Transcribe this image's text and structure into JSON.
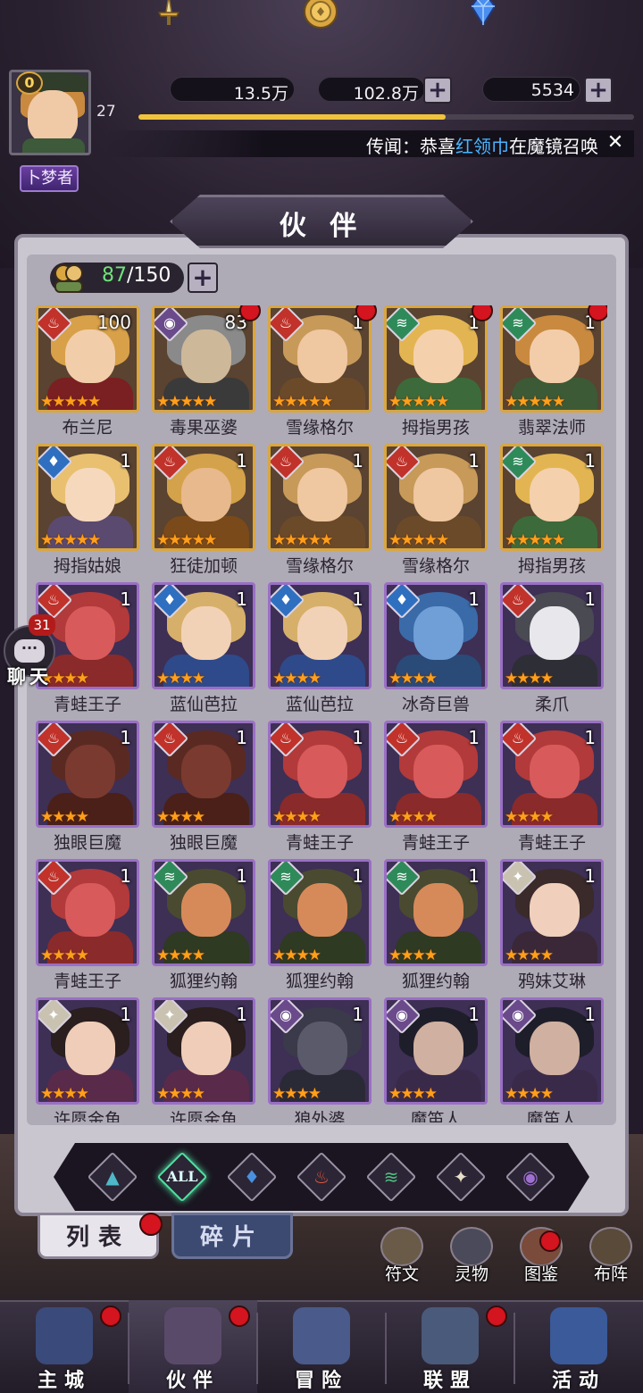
{
  "player": {
    "vip": "0",
    "level": "27",
    "exp_fraction": 0.62,
    "title": "卜梦者"
  },
  "resources": {
    "power": "13.5万",
    "gold": "102.8万",
    "diamond": "5534"
  },
  "rumor": {
    "prefix": "传闻：恭喜",
    "highlight": "红领巾",
    "suffix": "在魔镜召唤"
  },
  "panel": {
    "title": "伙 伴",
    "count_current": "87",
    "count_total": "/150"
  },
  "heroes": [
    {
      "name": "布兰尼",
      "level": "100",
      "stars": 5,
      "element": "fire",
      "frame": "gold",
      "dot": false,
      "hair": "#d8a048",
      "face": "#f2cda9",
      "body": "#7a1f22"
    },
    {
      "name": "毒果巫婆",
      "level": "83",
      "stars": 5,
      "element": "shadow",
      "frame": "gold",
      "dot": true,
      "hair": "#8a8a8a",
      "face": "#cdb89a",
      "body": "#3a3a3a"
    },
    {
      "name": "雪缘格尔",
      "level": "1",
      "stars": 5,
      "element": "fire",
      "frame": "gold",
      "dot": true,
      "hair": "#c79a5a",
      "face": "#efc7a0",
      "body": "#6b4a2a"
    },
    {
      "name": "拇指男孩",
      "level": "1",
      "stars": 5,
      "element": "wind",
      "frame": "gold",
      "dot": true,
      "hair": "#e3b552",
      "face": "#f4d0ac",
      "body": "#3d6a3a"
    },
    {
      "name": "翡翠法师",
      "level": "1",
      "stars": 5,
      "element": "wind",
      "frame": "gold",
      "dot": true,
      "hair": "#c98a3f",
      "face": "#f3cdaa",
      "body": "#3c5a36"
    },
    {
      "name": "拇指姑娘",
      "level": "1",
      "stars": 5,
      "element": "water",
      "frame": "gold",
      "dot": false,
      "hair": "#e8c070",
      "face": "#f6d8bd",
      "body": "#5a4a70"
    },
    {
      "name": "狂徒加顿",
      "level": "1",
      "stars": 5,
      "element": "fire",
      "frame": "gold",
      "dot": false,
      "hair": "#d4a24a",
      "face": "#e8b98c",
      "body": "#7a4a1a"
    },
    {
      "name": "雪缘格尔",
      "level": "1",
      "stars": 5,
      "element": "fire",
      "frame": "gold",
      "dot": false,
      "hair": "#c79a5a",
      "face": "#efc7a0",
      "body": "#6b4a2a"
    },
    {
      "name": "雪缘格尔",
      "level": "1",
      "stars": 5,
      "element": "fire",
      "frame": "gold",
      "dot": false,
      "hair": "#c79a5a",
      "face": "#efc7a0",
      "body": "#6b4a2a"
    },
    {
      "name": "拇指男孩",
      "level": "1",
      "stars": 5,
      "element": "wind",
      "frame": "gold",
      "dot": false,
      "hair": "#e3b552",
      "face": "#f4d0ac",
      "body": "#3d6a3a"
    },
    {
      "name": "青蛙王子",
      "level": "1",
      "stars": 4,
      "element": "fire",
      "frame": "purple",
      "dot": false,
      "hair": "#b23a3a",
      "face": "#d85a5a",
      "body": "#8a2a2a"
    },
    {
      "name": "蓝仙芭拉",
      "level": "1",
      "stars": 4,
      "element": "water",
      "frame": "purple",
      "dot": false,
      "hair": "#d6b06a",
      "face": "#f2d2b6",
      "body": "#2e4a8a"
    },
    {
      "name": "蓝仙芭拉",
      "level": "1",
      "stars": 4,
      "element": "water",
      "frame": "purple",
      "dot": false,
      "hair": "#d6b06a",
      "face": "#f2d2b6",
      "body": "#2e4a8a"
    },
    {
      "name": "冰奇巨兽",
      "level": "1",
      "stars": 4,
      "element": "water",
      "frame": "purple",
      "dot": false,
      "hair": "#3a6aa8",
      "face": "#6f9fd6",
      "body": "#2a4a78"
    },
    {
      "name": "柔爪",
      "level": "1",
      "stars": 4,
      "element": "fire",
      "frame": "purple",
      "dot": false,
      "hair": "#4a4a52",
      "face": "#e8e8ec",
      "body": "#2e2e36"
    },
    {
      "name": "独眼巨魔",
      "level": "1",
      "stars": 4,
      "element": "fire",
      "frame": "purple",
      "dot": false,
      "hair": "#5a2a22",
      "face": "#7a3a30",
      "body": "#4a2018"
    },
    {
      "name": "独眼巨魔",
      "level": "1",
      "stars": 4,
      "element": "fire",
      "frame": "purple",
      "dot": false,
      "hair": "#5a2a22",
      "face": "#7a3a30",
      "body": "#4a2018"
    },
    {
      "name": "青蛙王子",
      "level": "1",
      "stars": 4,
      "element": "fire",
      "frame": "purple",
      "dot": false,
      "hair": "#b23a3a",
      "face": "#d85a5a",
      "body": "#8a2a2a"
    },
    {
      "name": "青蛙王子",
      "level": "1",
      "stars": 4,
      "element": "fire",
      "frame": "purple",
      "dot": false,
      "hair": "#b23a3a",
      "face": "#d85a5a",
      "body": "#8a2a2a"
    },
    {
      "name": "青蛙王子",
      "level": "1",
      "stars": 4,
      "element": "fire",
      "frame": "purple",
      "dot": false,
      "hair": "#b23a3a",
      "face": "#d85a5a",
      "body": "#8a2a2a"
    },
    {
      "name": "青蛙王子",
      "level": "1",
      "stars": 4,
      "element": "fire",
      "frame": "purple",
      "dot": false,
      "hair": "#b23a3a",
      "face": "#d85a5a",
      "body": "#8a2a2a"
    },
    {
      "name": "狐狸约翰",
      "level": "1",
      "stars": 4,
      "element": "wind",
      "frame": "purple",
      "dot": false,
      "hair": "#4a4a30",
      "face": "#d68a5a",
      "body": "#2e3a22"
    },
    {
      "name": "狐狸约翰",
      "level": "1",
      "stars": 4,
      "element": "wind",
      "frame": "purple",
      "dot": false,
      "hair": "#4a4a30",
      "face": "#d68a5a",
      "body": "#2e3a22"
    },
    {
      "name": "狐狸约翰",
      "level": "1",
      "stars": 4,
      "element": "wind",
      "frame": "purple",
      "dot": false,
      "hair": "#4a4a30",
      "face": "#d68a5a",
      "body": "#2e3a22"
    },
    {
      "name": "鸦妹艾琳",
      "level": "1",
      "stars": 4,
      "element": "light",
      "frame": "purple",
      "dot": false,
      "hair": "#3a2a2a",
      "face": "#f0d0bc",
      "body": "#3a2838"
    },
    {
      "name": "许愿金鱼",
      "level": "1",
      "stars": 4,
      "element": "light",
      "frame": "purple",
      "dot": false,
      "hair": "#2a1e1e",
      "face": "#f0cdb8",
      "body": "#5a2a4a"
    },
    {
      "name": "许愿金鱼",
      "level": "1",
      "stars": 4,
      "element": "light",
      "frame": "purple",
      "dot": false,
      "hair": "#2a1e1e",
      "face": "#f0cdb8",
      "body": "#5a2a4a"
    },
    {
      "name": "狼外婆",
      "level": "1",
      "stars": 4,
      "element": "shadow",
      "frame": "purple",
      "dot": false,
      "hair": "#3a3a4a",
      "face": "#5a5a6a",
      "body": "#2a2a36"
    },
    {
      "name": "魔笛人",
      "level": "1",
      "stars": 4,
      "element": "shadow",
      "frame": "purple",
      "dot": false,
      "hair": "#1e1e2a",
      "face": "#d0b0a0",
      "body": "#3a2a4a"
    },
    {
      "name": "魔笛人",
      "level": "1",
      "stars": 4,
      "element": "shadow",
      "frame": "purple",
      "dot": false,
      "hair": "#1e1e2a",
      "face": "#d0b0a0",
      "body": "#3a2a4a"
    }
  ],
  "element_colors": {
    "fire": "#c0322a",
    "water": "#2f6fc0",
    "wind": "#2f8a5a",
    "light": "#c9c2b0",
    "shadow": "#6a4a8a",
    "neutral": "#2f7a8a"
  },
  "element_glyphs": {
    "fire": "♨",
    "water": "♦",
    "wind": "≋",
    "light": "✦",
    "shadow": "◉",
    "neutral": "▲"
  },
  "filters": [
    {
      "key": "neutral",
      "glyph": "▲",
      "color": "#4fb8c8"
    },
    {
      "key": "all",
      "label": "ALL",
      "color": "#4fe0a0"
    },
    {
      "key": "water",
      "glyph": "♦",
      "color": "#4a90e0"
    },
    {
      "key": "fire",
      "glyph": "♨",
      "color": "#e05a40"
    },
    {
      "key": "wind",
      "glyph": "≋",
      "color": "#4fc080"
    },
    {
      "key": "light",
      "glyph": "✦",
      "color": "#e8e0c8"
    },
    {
      "key": "shadow",
      "glyph": "◉",
      "color": "#a070d0"
    }
  ],
  "tabs": {
    "list": "列表",
    "fragments": "碎片"
  },
  "side_buttons": [
    {
      "label": "符文",
      "icon": "rune-icon"
    },
    {
      "label": "灵物",
      "icon": "spirit-icon"
    },
    {
      "label": "图鉴",
      "icon": "codex-icon"
    },
    {
      "label": "布阵",
      "icon": "formation-icon"
    }
  ],
  "chat": {
    "badge": "31",
    "label": "聊天"
  },
  "nav": [
    {
      "label": "主城",
      "dot": true
    },
    {
      "label": "伙伴",
      "dot": true
    },
    {
      "label": "冒险",
      "dot": false
    },
    {
      "label": "联盟",
      "dot": true
    },
    {
      "label": "活动",
      "dot": false
    }
  ]
}
